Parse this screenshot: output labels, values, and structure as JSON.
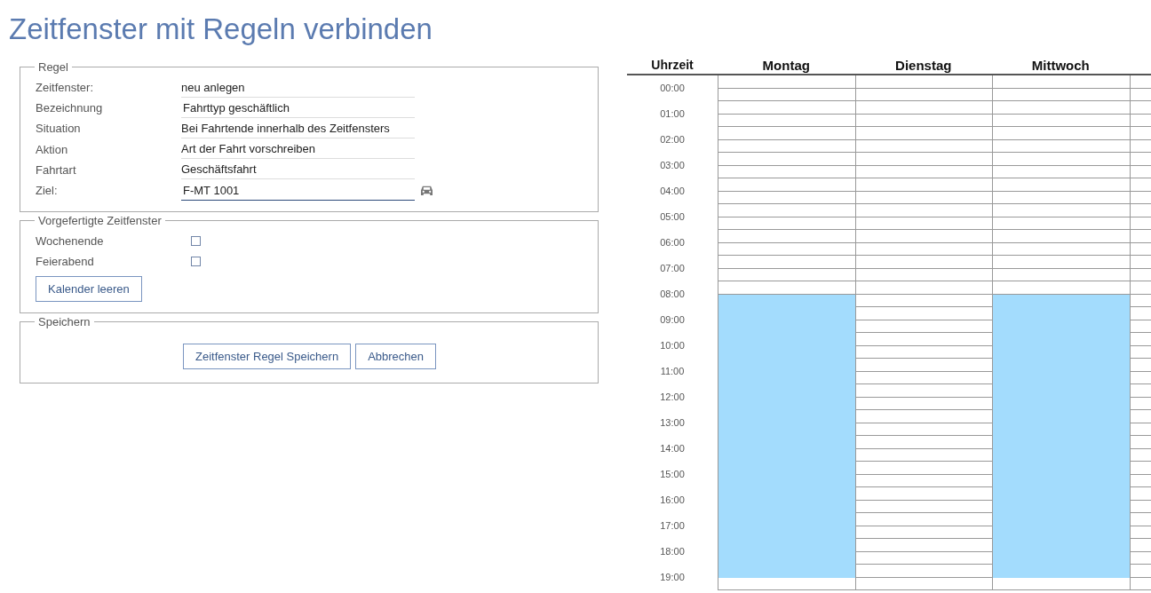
{
  "title": "Zeitfenster mit Regeln verbinden",
  "rule": {
    "legend": "Regel",
    "fields": [
      {
        "label": "Zeitfenster:",
        "value": "neu anlegen",
        "kind": "text",
        "focused": false
      },
      {
        "label": "Bezeichnung",
        "value": "Fahrttyp geschäftlich",
        "kind": "input",
        "focused": false
      },
      {
        "label": "Situation",
        "value": "Bei Fahrtende innerhalb des Zeitfensters",
        "kind": "text",
        "focused": false
      },
      {
        "label": "Aktion",
        "value": "Art der Fahrt vorschreiben",
        "kind": "text",
        "focused": false
      },
      {
        "label": "Fahrtart",
        "value": "Geschäftsfahrt",
        "kind": "text",
        "focused": false
      },
      {
        "label": "Ziel:",
        "value": "F-MT 1001",
        "kind": "input",
        "focused": true
      }
    ]
  },
  "presets": {
    "legend": "Vorgefertigte Zeitfenster",
    "options": [
      {
        "label": "Wochenende",
        "checked": false
      },
      {
        "label": "Feierabend",
        "checked": false
      }
    ],
    "clear_button": "Kalender leeren"
  },
  "save": {
    "legend": "Speichern",
    "buttons": [
      "Zeitfenster Regel Speichern",
      "Abbrechen"
    ]
  },
  "calendar": {
    "time_heading": "Uhrzeit",
    "hours": [
      "00:00",
      "01:00",
      "02:00",
      "03:00",
      "04:00",
      "05:00",
      "06:00",
      "07:00",
      "08:00",
      "09:00",
      "10:00",
      "11:00",
      "12:00",
      "13:00",
      "14:00",
      "15:00",
      "16:00",
      "17:00",
      "18:00",
      "19:00"
    ],
    "days": [
      {
        "name": "Montag",
        "slots": [
          false,
          false,
          false,
          false,
          false,
          false,
          false,
          false,
          false,
          false,
          false,
          false,
          false,
          false,
          false,
          false,
          false,
          true,
          true,
          true,
          true,
          true,
          true,
          true,
          true,
          true,
          true,
          true,
          true,
          true,
          true,
          true,
          true,
          true,
          true,
          true,
          true,
          true,
          true,
          false
        ]
      },
      {
        "name": "Dienstag",
        "slots": [
          false,
          false,
          false,
          false,
          false,
          false,
          false,
          false,
          false,
          false,
          false,
          false,
          false,
          false,
          false,
          false,
          false,
          false,
          false,
          false,
          false,
          false,
          false,
          false,
          false,
          false,
          false,
          false,
          false,
          false,
          false,
          false,
          false,
          false,
          false,
          false,
          false,
          false,
          false,
          false
        ]
      },
      {
        "name": "Mittwoch",
        "slots": [
          false,
          false,
          false,
          false,
          false,
          false,
          false,
          false,
          false,
          false,
          false,
          false,
          false,
          false,
          false,
          false,
          false,
          true,
          true,
          true,
          true,
          true,
          true,
          true,
          true,
          true,
          true,
          true,
          true,
          true,
          true,
          true,
          true,
          true,
          true,
          true,
          true,
          true,
          true,
          false
        ]
      },
      {
        "slots": [
          false,
          false,
          false,
          false,
          false,
          false,
          false,
          false,
          false,
          false,
          false,
          false,
          false,
          false,
          false,
          false,
          false,
          false,
          false,
          false,
          false,
          false,
          false,
          false,
          false,
          false,
          false,
          false,
          false,
          false,
          false,
          false,
          false,
          false,
          false,
          false,
          false,
          false,
          false,
          false
        ]
      }
    ]
  }
}
